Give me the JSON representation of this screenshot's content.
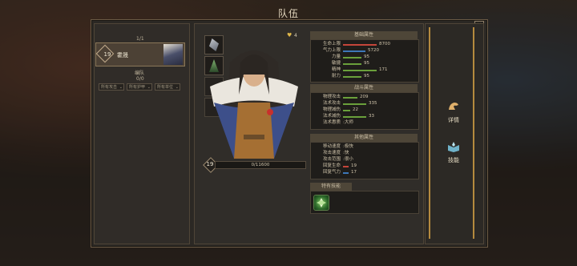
{
  "title": "队伍",
  "left_panel": {
    "count_top": "1/1",
    "hero_card": {
      "level": "19",
      "name": "霍晟"
    },
    "section_label": "编队",
    "count_bottom": "0/0",
    "filters": [
      "所有攻击",
      "所有护甲",
      "所有单位"
    ]
  },
  "hero": {
    "level": "19",
    "xp_text": "0/11600",
    "favor": "4",
    "xp_fraction": 0.0
  },
  "basic": {
    "header": "基础属性",
    "rows": [
      {
        "label": "生命上限",
        "value": "8700",
        "color": "#c4453a",
        "fill": 1.0
      },
      {
        "label": "气力上限",
        "value": "5720",
        "color": "#3d77b8",
        "fill": 0.66
      },
      {
        "label": "力量",
        "value": "95",
        "color": "#6aa03b",
        "fill": 0.55
      },
      {
        "label": "敏捷",
        "value": "95",
        "color": "#6aa03b",
        "fill": 0.55
      },
      {
        "label": "精神",
        "value": "171",
        "color": "#6aa03b",
        "fill": 1.0
      },
      {
        "label": "耐力",
        "value": "95",
        "color": "#6aa03b",
        "fill": 0.55
      }
    ]
  },
  "combat": {
    "header": "战斗属性",
    "rows": [
      {
        "label": "物理攻击",
        "value": "209",
        "color": "#6aa03b",
        "fill": 0.5
      },
      {
        "label": "法术攻击",
        "value": "335",
        "color": "#6aa03b",
        "fill": 0.8
      },
      {
        "label": "物理减伤",
        "value": "22",
        "color": "#6aa03b",
        "fill": 0.25
      },
      {
        "label": "法术减伤",
        "value": "33",
        "color": "#6aa03b",
        "fill": 0.8
      },
      {
        "label": "法术惠质",
        "value": "大师",
        "color": "",
        "fill": 0
      }
    ]
  },
  "special": {
    "header": "其他属性",
    "rows": [
      {
        "label": "移动速度",
        "value": "极快",
        "color": "",
        "fill": 0
      },
      {
        "label": "攻击速度",
        "value": "快",
        "color": "",
        "fill": 0
      },
      {
        "label": "攻击范围",
        "value": "很小",
        "color": "",
        "fill": 0
      },
      {
        "label": "回复生命",
        "value": "19",
        "color": "#c4453a",
        "fill": 0.2
      },
      {
        "label": "回复气力",
        "value": "17",
        "color": "#3d77b8",
        "fill": 0.2
      }
    ]
  },
  "skills": {
    "header": "特有技能"
  },
  "side_buttons": [
    {
      "label": "详情",
      "icon": "arm-icon"
    },
    {
      "label": "技能",
      "icon": "book-icon"
    }
  ],
  "colors": {
    "accent": "#b58a3e",
    "panel": "#302d29"
  }
}
